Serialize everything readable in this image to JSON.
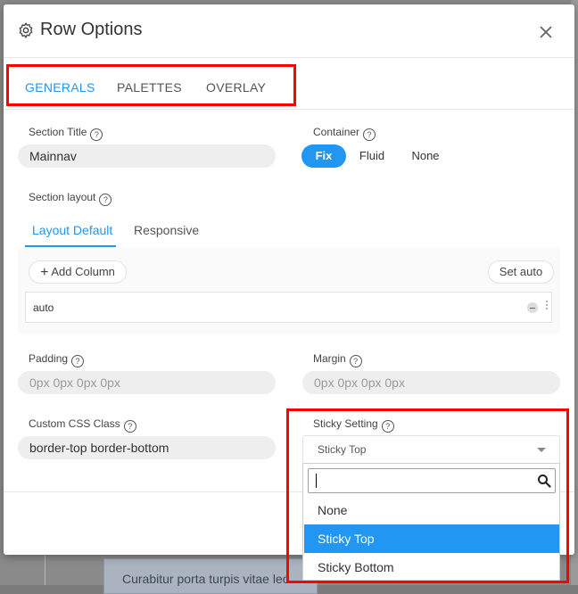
{
  "background": {
    "note_text": "Curabitur porta turpis vitae leo"
  },
  "modal": {
    "title": "Row Options",
    "tabs": [
      {
        "label": "GENERALS",
        "active": true
      },
      {
        "label": "PALETTES",
        "active": false
      },
      {
        "label": "OVERLAY",
        "active": false
      }
    ]
  },
  "form": {
    "section_title": {
      "label": "Section Title",
      "value": "Mainnav"
    },
    "container": {
      "label": "Container",
      "options": [
        "Fix",
        "Fluid",
        "None"
      ],
      "selected": "Fix"
    },
    "section_layout": {
      "label": "Section layout",
      "tabs": [
        {
          "label": "Layout Default",
          "active": true
        },
        {
          "label": "Responsive",
          "active": false
        }
      ],
      "add_column_label": "Add Column",
      "set_auto_label": "Set auto",
      "row_value": "auto"
    },
    "padding": {
      "label": "Padding",
      "placeholder": "0px 0px 0px 0px"
    },
    "margin": {
      "label": "Margin",
      "placeholder": "0px 0px 0px 0px"
    },
    "custom_css": {
      "label": "Custom CSS Class",
      "value": "border-top border-bottom"
    },
    "sticky": {
      "label": "Sticky Setting",
      "selected": "Sticky Top",
      "search_value": "",
      "options": [
        "None",
        "Sticky Top",
        "Sticky Bottom"
      ]
    }
  },
  "colors": {
    "accent": "#2196f3",
    "highlight": "#ff0000"
  }
}
